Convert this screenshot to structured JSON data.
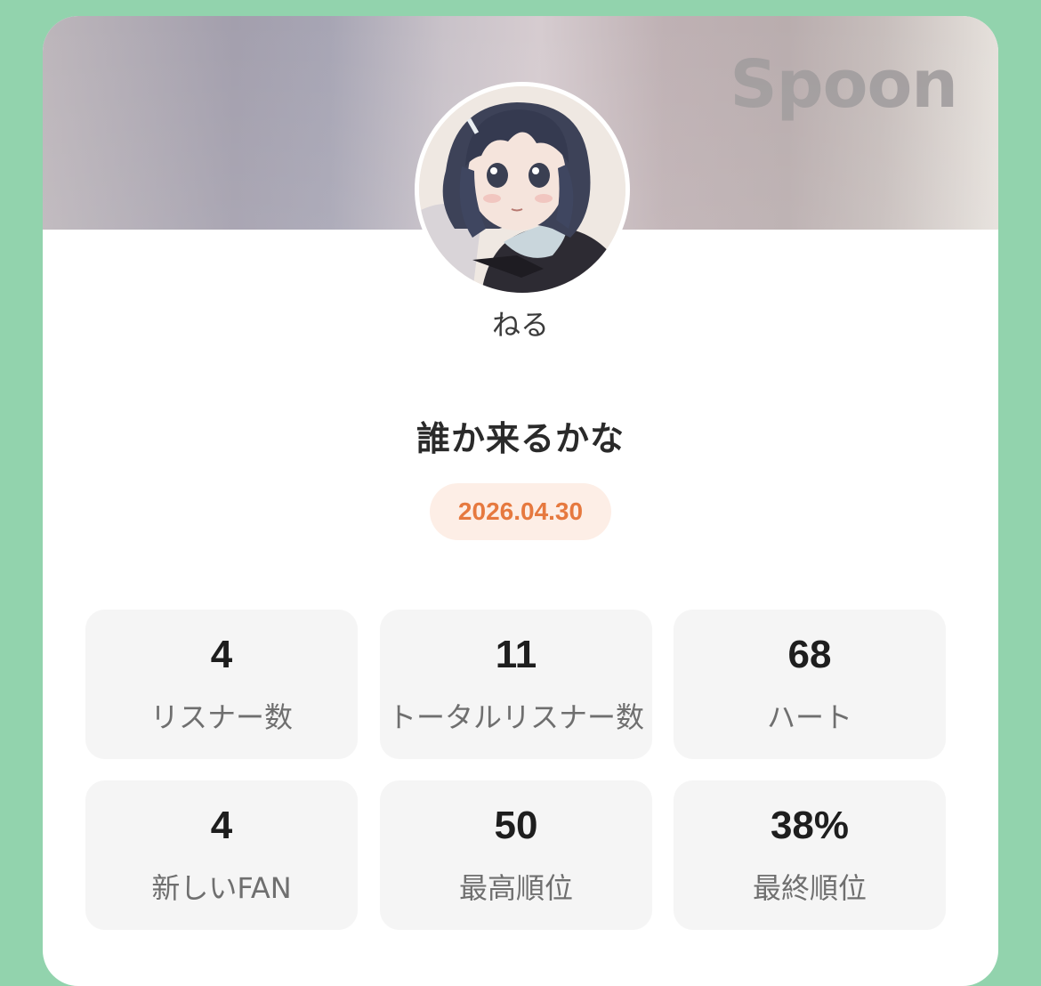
{
  "banner": {
    "logo_text": "Spoon"
  },
  "profile": {
    "username": "ねる",
    "avatar_icon": "avatar-illustration"
  },
  "broadcast": {
    "title": "誰か来るかな",
    "date": "2026.04.30"
  },
  "stats": [
    {
      "value": "4",
      "label": "リスナー数"
    },
    {
      "value": "11",
      "label": "トータルリスナー数"
    },
    {
      "value": "68",
      "label": "ハート"
    },
    {
      "value": "4",
      "label": "新しいFAN"
    },
    {
      "value": "50",
      "label": "最高順位"
    },
    {
      "value": "38%",
      "label": "最終順位"
    }
  ],
  "colors": {
    "background": "#92d3ad",
    "card": "#ffffff",
    "date_text": "#e6793f",
    "date_badge": "#fdeee6",
    "stat_tile": "#f5f5f5"
  }
}
